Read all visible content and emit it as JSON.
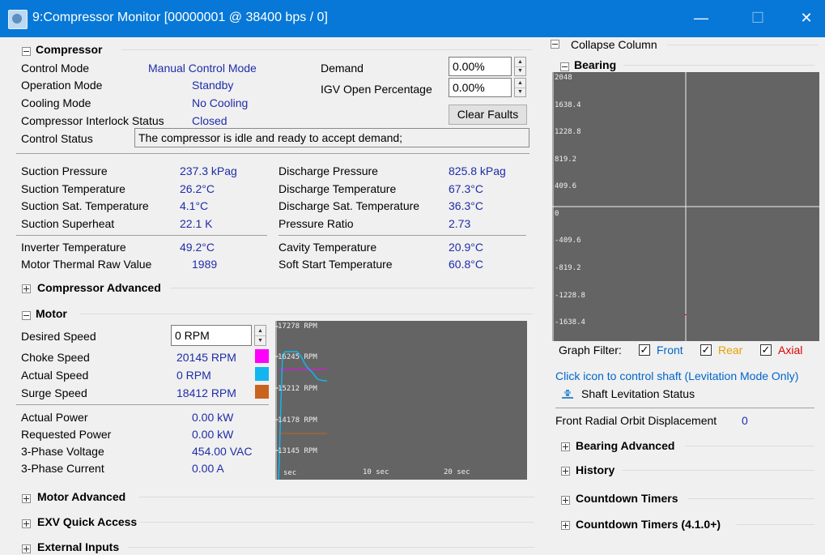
{
  "window": {
    "title": "9:Compressor Monitor [00000001 @ 38400 bps / 0]",
    "min_glyph": "—",
    "max_glyph": "☐",
    "close_glyph": "✕"
  },
  "compressor": {
    "header": "Compressor",
    "control_mode_label": "Control Mode",
    "control_mode_value": "Manual Control Mode",
    "operation_mode_label": "Operation Mode",
    "operation_mode_value": "Standby",
    "cooling_mode_label": "Cooling Mode",
    "cooling_mode_value": "No Cooling",
    "interlock_label": "Compressor Interlock Status",
    "interlock_value": "Closed",
    "control_status_label": "Control Status",
    "control_status_value": "The compressor is idle and ready to accept demand;",
    "demand_label": "Demand",
    "demand_value": "0.00%",
    "igv_label": "IGV Open Percentage",
    "igv_value": "0.00%",
    "clear_faults": "Clear Faults",
    "suction_pressure_label": "Suction Pressure",
    "suction_pressure_value": "237.3 kPag",
    "suction_temp_label": "Suction Temperature",
    "suction_temp_value": "26.2°C",
    "suction_sat_label": "Suction Sat. Temperature",
    "suction_sat_value": "4.1°C",
    "suction_superheat_label": "Suction Superheat",
    "suction_superheat_value": "22.1 K",
    "discharge_pressure_label": "Discharge Pressure",
    "discharge_pressure_value": "825.8 kPag",
    "discharge_temp_label": "Discharge Temperature",
    "discharge_temp_value": "67.3°C",
    "discharge_sat_label": "Discharge Sat. Temperature",
    "discharge_sat_value": "36.3°C",
    "pressure_ratio_label": "Pressure Ratio",
    "pressure_ratio_value": "2.73",
    "inverter_temp_label": "Inverter Temperature",
    "inverter_temp_value": "49.2°C",
    "motor_thermal_label": "Motor Thermal Raw Value",
    "motor_thermal_value": "1989",
    "cavity_temp_label": "Cavity Temperature",
    "cavity_temp_value": "20.9°C",
    "soft_start_label": "Soft Start Temperature",
    "soft_start_value": "60.8°C"
  },
  "compressor_advanced": {
    "header": "Compressor Advanced"
  },
  "motor": {
    "header": "Motor",
    "desired_speed_label": "Desired Speed",
    "desired_speed_value": "0 RPM",
    "choke_speed_label": "Choke Speed",
    "choke_speed_value": "20145 RPM",
    "choke_color": "#ff00ff",
    "actual_speed_label": "Actual Speed",
    "actual_speed_value": "0 RPM",
    "actual_color": "#12b5f0",
    "surge_speed_label": "Surge Speed",
    "surge_speed_value": "18412 RPM",
    "surge_color": "#c8641e",
    "actual_power_label": "Actual Power",
    "actual_power_value": "0.00 kW",
    "requested_power_label": "Requested Power",
    "requested_power_value": "0.00 kW",
    "voltage_label": "3-Phase Voltage",
    "voltage_value": "454.00 VAC",
    "current_label": "3-Phase Current",
    "current_value": "0.00 A",
    "graph": {
      "y_ticks": [
        "17278 RPM",
        "16245 RPM",
        "15212 RPM",
        "14178 RPM",
        "13145 RPM"
      ],
      "x_ticks": [
        "sec",
        "10 sec",
        "20 sec"
      ]
    }
  },
  "motor_advanced": {
    "header": "Motor Advanced"
  },
  "exv": {
    "header": "EXV Quick Access"
  },
  "external_inputs": {
    "header": "External Inputs"
  },
  "right": {
    "collapse_column": "Collapse Column",
    "bearing_header": "Bearing",
    "bearing_ticks": [
      "2048",
      "1638.4",
      "1228.8",
      "819.2",
      "409.6",
      "0",
      "-409.6",
      "-819.2",
      "-1228.8",
      "-1638.4"
    ],
    "graph_filter_label": "Graph Filter:",
    "filter_front": "Front",
    "filter_rear": "Rear",
    "filter_axial": "Axial",
    "front_color": "#0066cc",
    "rear_color": "#e8a000",
    "axial_color": "#e00000",
    "click_icon_text": "Click icon to control shaft (Levitation Mode Only)",
    "shaft_status": "Shaft Levitation Status",
    "orbit_label": "Front Radial Orbit Displacement",
    "orbit_value": "0",
    "bearing_advanced": "Bearing Advanced",
    "history": "History",
    "countdown": "Countdown Timers",
    "countdown_410": "Countdown Timers (4.1.0+)"
  }
}
